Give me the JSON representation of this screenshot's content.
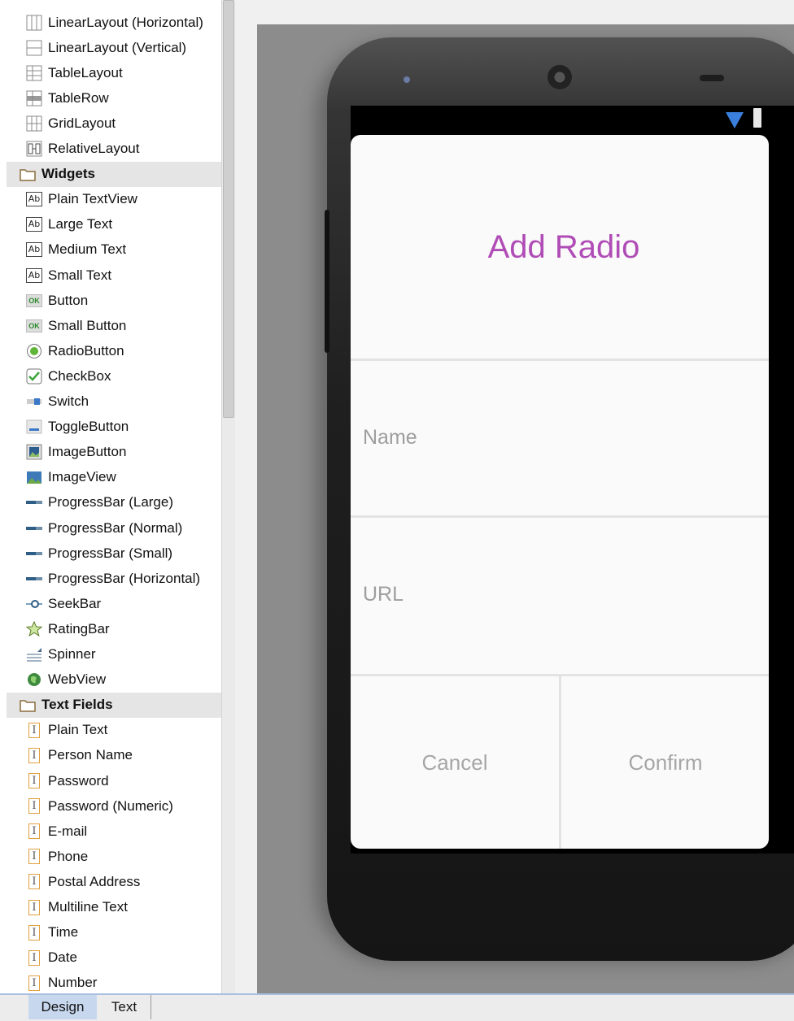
{
  "palette": {
    "layouts": [
      {
        "label": "LinearLayout (Horizontal)",
        "icon": "linearlayout-horizontal-icon"
      },
      {
        "label": "LinearLayout (Vertical)",
        "icon": "linearlayout-vertical-icon"
      },
      {
        "label": "TableLayout",
        "icon": "tablelayout-icon"
      },
      {
        "label": "TableRow",
        "icon": "tablerow-icon"
      },
      {
        "label": "GridLayout",
        "icon": "gridlayout-icon"
      },
      {
        "label": "RelativeLayout",
        "icon": "relativelayout-icon"
      }
    ],
    "widgets_label": "Widgets",
    "widgets": [
      {
        "label": "Plain TextView",
        "icon": "textview-icon",
        "glyph": "Ab"
      },
      {
        "label": "Large Text",
        "icon": "textview-icon",
        "glyph": "Ab"
      },
      {
        "label": "Medium Text",
        "icon": "textview-icon",
        "glyph": "Ab"
      },
      {
        "label": "Small Text",
        "icon": "textview-icon",
        "glyph": "Ab"
      },
      {
        "label": "Button",
        "icon": "button-icon",
        "glyph": "OK"
      },
      {
        "label": "Small Button",
        "icon": "button-icon",
        "glyph": "OK"
      },
      {
        "label": "RadioButton",
        "icon": "radiobutton-icon"
      },
      {
        "label": "CheckBox",
        "icon": "checkbox-icon"
      },
      {
        "label": "Switch",
        "icon": "switch-icon"
      },
      {
        "label": "ToggleButton",
        "icon": "togglebutton-icon"
      },
      {
        "label": "ImageButton",
        "icon": "imagebutton-icon"
      },
      {
        "label": "ImageView",
        "icon": "imageview-icon"
      },
      {
        "label": "ProgressBar (Large)",
        "icon": "progressbar-icon"
      },
      {
        "label": "ProgressBar (Normal)",
        "icon": "progressbar-icon"
      },
      {
        "label": "ProgressBar (Small)",
        "icon": "progressbar-icon"
      },
      {
        "label": "ProgressBar (Horizontal)",
        "icon": "progressbar-icon"
      },
      {
        "label": "SeekBar",
        "icon": "seekbar-icon"
      },
      {
        "label": "RatingBar",
        "icon": "ratingbar-icon"
      },
      {
        "label": "Spinner",
        "icon": "spinner-icon"
      },
      {
        "label": "WebView",
        "icon": "webview-icon"
      }
    ],
    "textfields_label": "Text Fields",
    "textfields": [
      {
        "label": "Plain Text"
      },
      {
        "label": "Person Name"
      },
      {
        "label": "Password"
      },
      {
        "label": "Password (Numeric)"
      },
      {
        "label": "E-mail"
      },
      {
        "label": "Phone"
      },
      {
        "label": "Postal Address"
      },
      {
        "label": "Multiline Text"
      },
      {
        "label": "Time"
      },
      {
        "label": "Date"
      },
      {
        "label": "Number"
      }
    ]
  },
  "dialog": {
    "title": "Add Radio",
    "name_hint": "Name",
    "url_hint": "URL",
    "cancel_label": "Cancel",
    "confirm_label": "Confirm",
    "title_color": "#b04cb6"
  },
  "tabs": {
    "design": "Design",
    "text": "Text"
  }
}
